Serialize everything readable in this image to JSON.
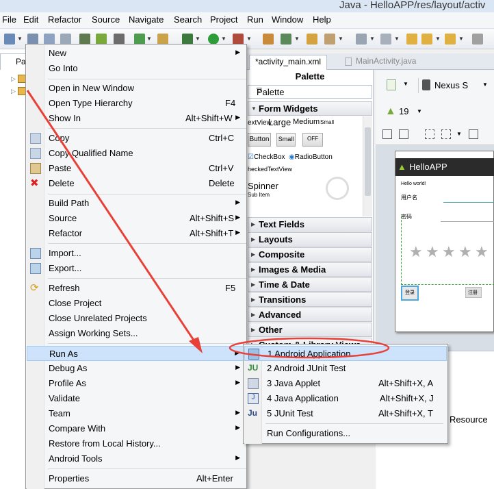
{
  "window": {
    "title": "Java - HelloAPP/res/layout/activ"
  },
  "menubar": [
    "File",
    "Edit",
    "Refactor",
    "Source",
    "Navigate",
    "Search",
    "Project",
    "Run",
    "Window",
    "Help"
  ],
  "explorer": {
    "tab_label": "Pa"
  },
  "editor_tabs": {
    "active": "*activity_main.xml",
    "inactive": "MainActivity.java"
  },
  "palette": {
    "header": "Palette",
    "combo": "Palette",
    "categories": [
      "Form Widgets",
      "Text Fields",
      "Layouts",
      "Composite",
      "Images & Media",
      "Time & Date",
      "Transitions",
      "Advanced",
      "Other",
      "Custom & Library Views"
    ],
    "widgets": {
      "textview": "extView",
      "large": "Large",
      "medium": "Medium",
      "small": "Small",
      "button": "Button",
      "small_button": "Small",
      "off": "OFF",
      "checkbox": "CheckBox",
      "radio": "RadioButton",
      "checked": "heckedTextView",
      "spinner": "Spinner",
      "subitem": "Sub Item"
    }
  },
  "device": {
    "name": "Nexus S",
    "api": "19"
  },
  "phone": {
    "app_title": "HelloAPP",
    "hello": "Hello world!",
    "user_label": "用户名",
    "password_label": "密码",
    "login_btn": "登录",
    "register_btn": "注册"
  },
  "bottom": {
    "resource": "Resource"
  },
  "context_menu": {
    "items": [
      {
        "label": "New",
        "accel": "",
        "sub": true
      },
      {
        "label": "Go Into",
        "accel": "",
        "sub": false
      },
      {
        "label": "Open in New Window",
        "accel": "",
        "sub": false
      },
      {
        "label": "Open Type Hierarchy",
        "accel": "F4",
        "sub": false
      },
      {
        "label": "Show In",
        "accel": "Alt+Shift+W",
        "sub": true
      },
      {
        "label": "Copy",
        "accel": "Ctrl+C",
        "sub": false
      },
      {
        "label": "Copy Qualified Name",
        "accel": "",
        "sub": false
      },
      {
        "label": "Paste",
        "accel": "Ctrl+V",
        "sub": false
      },
      {
        "label": "Delete",
        "accel": "Delete",
        "sub": false
      },
      {
        "label": "Build Path",
        "accel": "",
        "sub": true
      },
      {
        "label": "Source",
        "accel": "Alt+Shift+S",
        "sub": true
      },
      {
        "label": "Refactor",
        "accel": "Alt+Shift+T",
        "sub": true
      },
      {
        "label": "Import...",
        "accel": "",
        "sub": false
      },
      {
        "label": "Export...",
        "accel": "",
        "sub": false
      },
      {
        "label": "Refresh",
        "accel": "F5",
        "sub": false
      },
      {
        "label": "Close Project",
        "accel": "",
        "sub": false
      },
      {
        "label": "Close Unrelated Projects",
        "accel": "",
        "sub": false
      },
      {
        "label": "Assign Working Sets...",
        "accel": "",
        "sub": false
      },
      {
        "label": "Run As",
        "accel": "",
        "sub": true
      },
      {
        "label": "Debug As",
        "accel": "",
        "sub": true
      },
      {
        "label": "Profile As",
        "accel": "",
        "sub": true
      },
      {
        "label": "Validate",
        "accel": "",
        "sub": false
      },
      {
        "label": "Team",
        "accel": "",
        "sub": true
      },
      {
        "label": "Compare With",
        "accel": "",
        "sub": true
      },
      {
        "label": "Restore from Local History...",
        "accel": "",
        "sub": false
      },
      {
        "label": "Android Tools",
        "accel": "",
        "sub": true
      },
      {
        "label": "Properties",
        "accel": "Alt+Enter",
        "sub": false
      }
    ]
  },
  "run_as_submenu": {
    "items": [
      {
        "label": "1 Android Application",
        "accel": ""
      },
      {
        "label": "2 Android JUnit Test",
        "accel": ""
      },
      {
        "label": "3 Java Applet",
        "accel": "Alt+Shift+X, A"
      },
      {
        "label": "4 Java Application",
        "accel": "Alt+Shift+X, J"
      },
      {
        "label": "5 JUnit Test",
        "accel": "Alt+Shift+X, T"
      },
      {
        "label": "Run Configurations...",
        "accel": ""
      }
    ]
  },
  "colors": {
    "highlight": "#cde3fb",
    "annotation": "#e8413a"
  }
}
